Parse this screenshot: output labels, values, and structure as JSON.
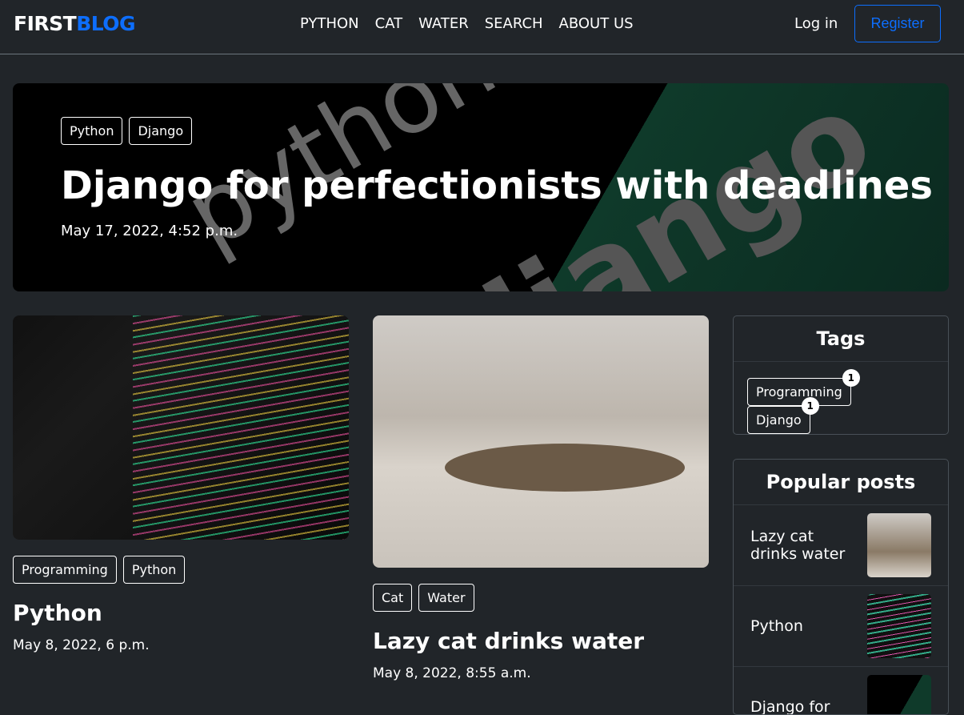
{
  "nav": {
    "brand_first": "FIRST",
    "brand_second": "BLOG",
    "links": [
      "PYTHON",
      "CAT",
      "WATER",
      "SEARCH",
      "ABOUT US"
    ],
    "login": "Log in",
    "register": "Register"
  },
  "hero": {
    "tags": [
      "Python",
      "Django"
    ],
    "title": "Django for perfectionists with deadlines",
    "date": "May 17, 2022, 4:52 p.m."
  },
  "posts": [
    {
      "tags": [
        "Programming",
        "Python"
      ],
      "title": "Python",
      "date": "May 8, 2022, 6 p.m."
    },
    {
      "tags": [
        "Cat",
        "Water"
      ],
      "title": "Lazy cat drinks water",
      "date": "May 8, 2022, 8:55 a.m."
    }
  ],
  "sidebar": {
    "tags_title": "Tags",
    "tags": [
      {
        "label": "Programming",
        "count": "1"
      },
      {
        "label": "Django",
        "count": "1"
      }
    ],
    "popular_title": "Popular posts",
    "popular": [
      "Lazy cat drinks water",
      "Python",
      "Django for"
    ]
  }
}
